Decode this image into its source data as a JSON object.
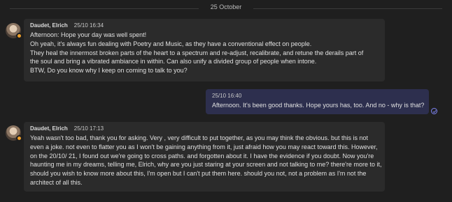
{
  "date_divider": "25 October",
  "colors": {
    "background": "#1f1f1f",
    "incoming_bubble": "#2b2b2b",
    "outgoing_bubble": "#2d2f4e",
    "status_away": "#f0a02a",
    "accent": "#7f85f5"
  },
  "messages": [
    {
      "author": "Daudet, Elrich",
      "timestamp": "25/10 16:34",
      "lines": [
        "Afternoon: Hope your day was well spent!",
        "Oh yeah, it's always fun dealing with Poetry and Music, as they have a conventional effect on people.",
        "They heal the innermost broken parts of the heart to a spectrum and re-adjust, recalibrate, and retune the derails part of",
        "the soul and bring a vibrated ambiance in within. Can also unify a divided group of people when intone.",
        "BTW, Do you know why I keep on coming to talk to you?"
      ]
    },
    {
      "timestamp": "25/10 16:40",
      "lines": [
        "Afternoon. It's been good thanks. Hope yours has, too. And no - why is that?"
      ]
    },
    {
      "author": "Daudet, Elrich",
      "timestamp": "25/10 17:13",
      "lines": [
        "Yeah wasn't too bad, thank you for asking. Very , very difficult to put together, as you may think the obvious. but this is not",
        "even a joke. not even to flatter you as I won't be gaining anything from it, just afraid how you may react toward this. However,",
        "on the 20/10/ 21, I found out we're going to cross paths. and forgotten about it. I have the evidence if you doubt. Now you're",
        "haunting me in my dreams, telling me, Elrich, why are you just staring at your screen and not talking to me? there're more to it,",
        "should you wish to know more about this, I'm open but I can't put them here. should you not, not a problem as I'm not the",
        "architect of all this."
      ]
    }
  ]
}
